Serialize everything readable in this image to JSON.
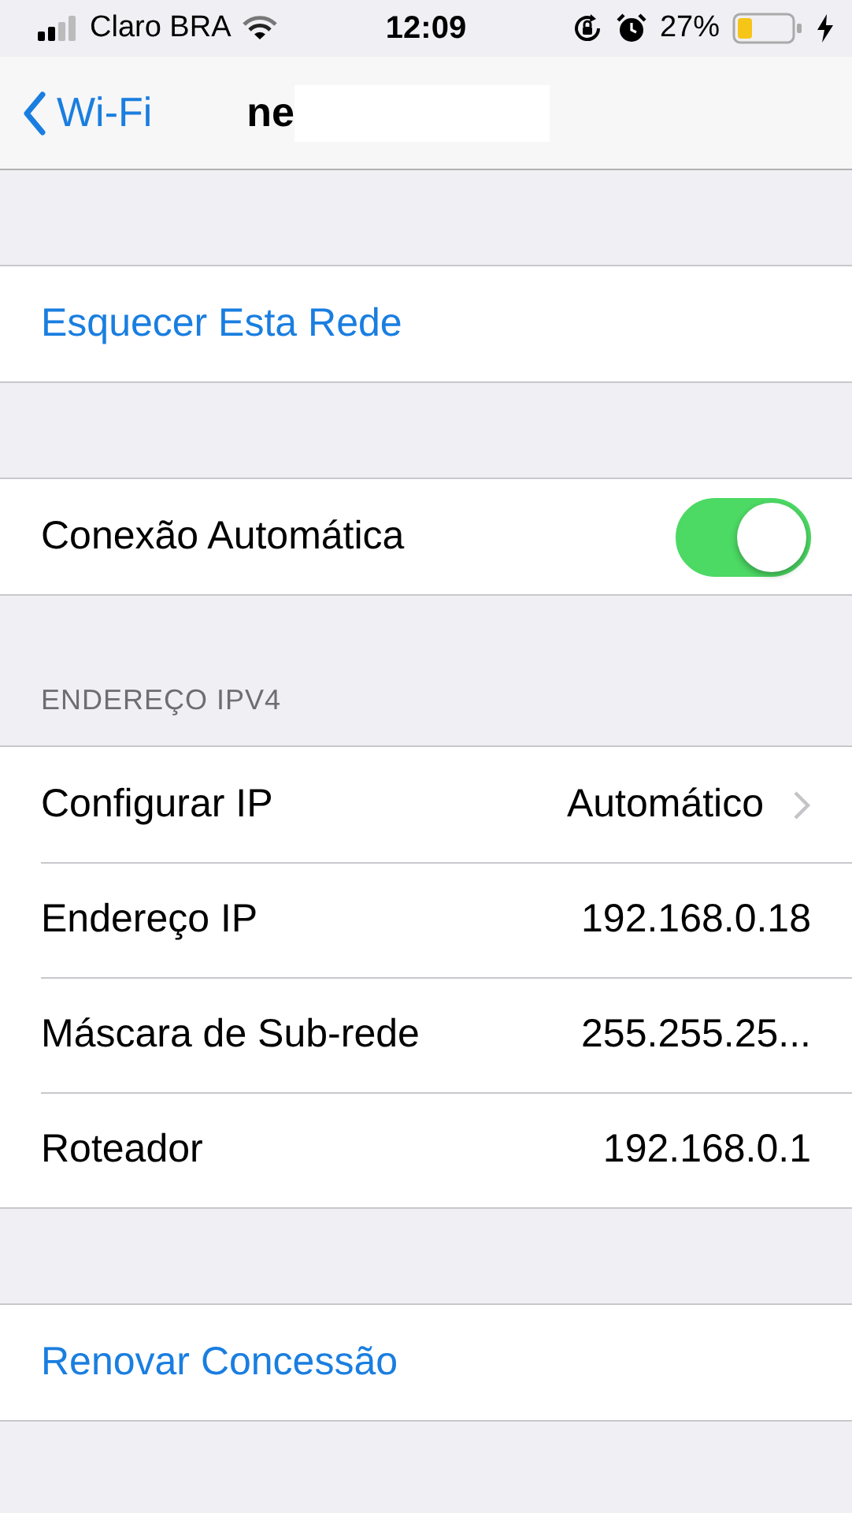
{
  "status_bar": {
    "carrier": "Claro BRA",
    "time": "12:09",
    "battery_percent": "27%"
  },
  "nav": {
    "back": "Wi-Fi",
    "title": "ne"
  },
  "groups": [
    {
      "rows": [
        {
          "kind": "action",
          "label": "Esquecer Esta Rede"
        }
      ]
    },
    {
      "rows": [
        {
          "kind": "toggle",
          "label": "Conexão Automática",
          "on": true
        }
      ]
    },
    {
      "header": "ENDEREÇO IPV4",
      "rows": [
        {
          "kind": "link",
          "label": "Configurar IP",
          "value": "Automático"
        },
        {
          "kind": "info",
          "label": "Endereço IP",
          "value": "192.168.0.18"
        },
        {
          "kind": "info",
          "label": "Máscara de Sub-rede",
          "value": "255.255.25..."
        },
        {
          "kind": "info",
          "label": "Roteador",
          "value": "192.168.0.1"
        }
      ]
    },
    {
      "rows": [
        {
          "kind": "action",
          "label": "Renovar Concessão"
        }
      ]
    }
  ]
}
